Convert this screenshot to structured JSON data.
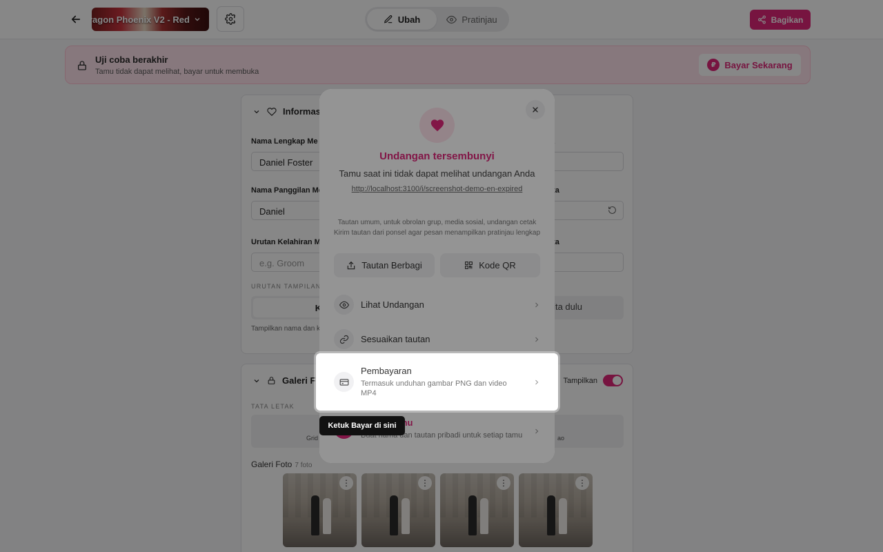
{
  "topbar": {
    "theme_label": "ragon Phoenix V2 - Red",
    "tabs": [
      {
        "label": "Ubah",
        "active": true
      },
      {
        "label": "Pratinjau",
        "active": false
      }
    ],
    "share_label": "Bagikan"
  },
  "banner": {
    "title": "Uji coba berakhir",
    "subtitle": "Tamu tidak dapat melihat, bayar untuk membuka",
    "pay_label": "Bayar Sekarang"
  },
  "card1": {
    "title": "Informasi",
    "full_name_label": "Nama Lengkap Me",
    "full_name_value": "Daniel Foster",
    "nick_label": "Nama Panggilan Me",
    "nick_value": "Daniel",
    "order_label": "Urutan Kelahiran M",
    "order_placeholder": "e.g. Groom",
    "right_label_1": "a",
    "right_label_2": "ita",
    "right_label_3": "ita",
    "display_order_caption": "URUTAN TAMPILAN",
    "order_option_1": "Keluarg",
    "order_option_2": "nita dulu",
    "help_text": "Tampilkan nama dan k"
  },
  "card2": {
    "title": "Galeri Fo",
    "toggle_label": "Tampilkan",
    "layout_caption": "TATA LETAK",
    "layout_option_1": "Grid",
    "layout_option_2": "ao",
    "gallery_label": "Galeri Foto",
    "gallery_count": "7 foto",
    "photos": [
      {
        "kebab": "⋮"
      },
      {
        "kebab": "⋮"
      },
      {
        "kebab": "⋮"
      },
      {
        "kebab": "⋮"
      }
    ]
  },
  "modal": {
    "title": "Undangan tersembunyi",
    "subtitle": "Tamu saat ini tidak dapat melihat undangan Anda",
    "url": "http://localhost:3100/i/screenshot-demo-en-expired",
    "note": "Tautan umum, untuk obrolan grup, media sosial, undangan cetak Kirim tautan dari ponsel agar pesan menampilkan pratinjau lengkap",
    "share_link_label": "Tautan Berbagi",
    "qr_label": "Kode QR",
    "items": [
      {
        "title": "Lihat Undangan",
        "desc": ""
      },
      {
        "title": "Sesuaikan tautan",
        "desc": ""
      },
      {
        "title": "Pembayaran",
        "desc": "Termasuk unduhan gambar PNG dan video MP4"
      },
      {
        "title": "mu",
        "desc": "Buat nama dan tautan pribadi untuk setiap tamu"
      }
    ]
  },
  "tooltip": {
    "text": "Ketuk Bayar di sini"
  },
  "colors": {
    "accent": "#e0267a",
    "accent_soft": "#ffe3ec"
  }
}
